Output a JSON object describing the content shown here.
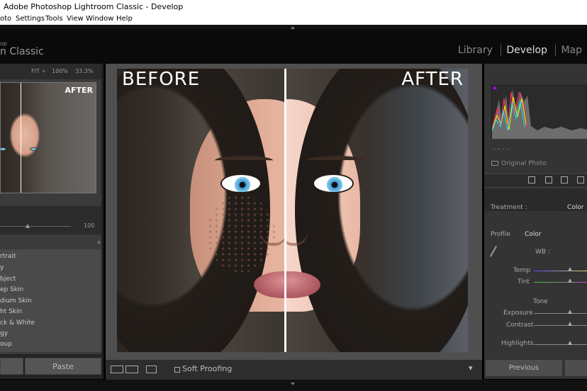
{
  "window": {
    "title": "Adobe Photoshop Lightroom Classic - Develop",
    "menu": [
      "oto",
      "Settings",
      "Tools",
      "View",
      "Window",
      "Help"
    ]
  },
  "identity": {
    "small": "op",
    "big": "n Classic",
    "modules": [
      "Library",
      "Develop",
      "Map"
    ]
  },
  "navigator": {
    "fit": "FIT ÷",
    "zoom1": "100%",
    "zoom2": "33.3%",
    "after_label": "AFTER"
  },
  "left_controls": {
    "slider_value": "100",
    "plus": "+",
    "presets": [
      "rtrait",
      "y",
      "bject",
      "ep Skin",
      "dium Skin",
      "ht Skin",
      "ck & White",
      "gy",
      "oup"
    ],
    "paste_label": "Paste"
  },
  "main_photo": {
    "before_label": "BEFORE",
    "after_label": "AFTER"
  },
  "toolbar": {
    "soft_proofing": "Soft Proofing"
  },
  "right_panel": {
    "original_photo": "Original Photo",
    "treatment_label": "Treatment :",
    "treatment_value": "Color",
    "profile_label": "Profile",
    "profile_value": "Color",
    "wb_label": "WB :",
    "temp_label": "Temp",
    "tint_label": "Tint",
    "tone_label": "Tone",
    "exposure_label": "Exposure",
    "contrast_label": "Contrast",
    "highlights_label": "Highlights",
    "previous_label": "Previous"
  },
  "colors": {
    "accent_purple": "#b300ff",
    "lightroom_dark": "#343434",
    "photo_divider": "#ffffff",
    "eye_blue": "#77c9ee"
  }
}
